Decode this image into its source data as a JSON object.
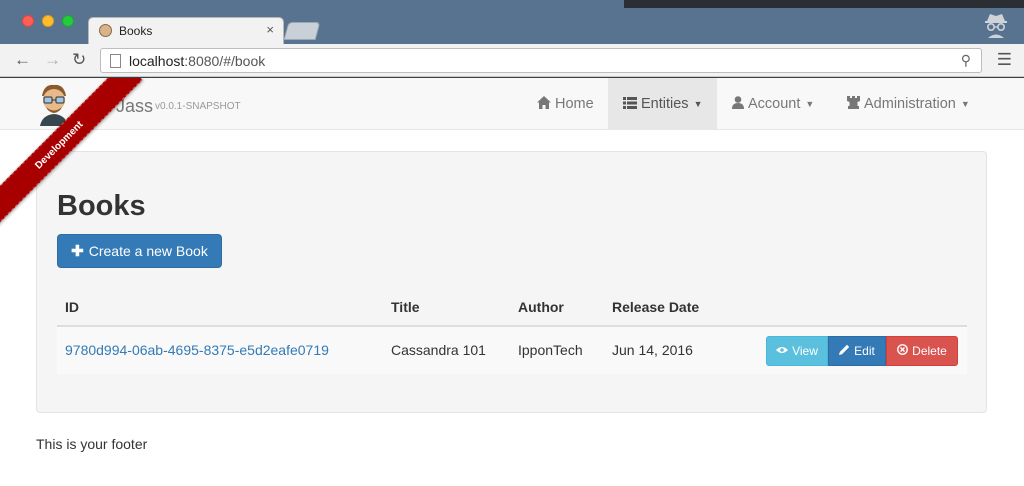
{
  "browser": {
    "tab_title": "Books",
    "tab_close": "×",
    "url_host": "localhost",
    "url_rest": ":8080/#/book"
  },
  "app": {
    "brand_name": "Jass",
    "brand_version": "v0.0.1-SNAPSHOT",
    "ribbon": "Development",
    "nav": {
      "home": "Home",
      "entities": "Entities",
      "account": "Account",
      "administration": "Administration"
    }
  },
  "main": {
    "title": "Books",
    "create_button": "Create a new Book",
    "table": {
      "headers": [
        "ID",
        "Title",
        "Author",
        "Release Date"
      ],
      "rows": [
        {
          "id": "9780d994-06ab-4695-8375-e5d2eafe0719",
          "title": "Cassandra 101",
          "author": "IpponTech",
          "release_date": "Jun 14, 2016"
        }
      ],
      "actions": {
        "view": "View",
        "edit": "Edit",
        "delete": "Delete"
      }
    }
  },
  "footer": "This is your footer",
  "colors": {
    "primary": "#337ab7",
    "info": "#5bc0de",
    "danger": "#d9534f",
    "ribbon": "#a80000"
  }
}
